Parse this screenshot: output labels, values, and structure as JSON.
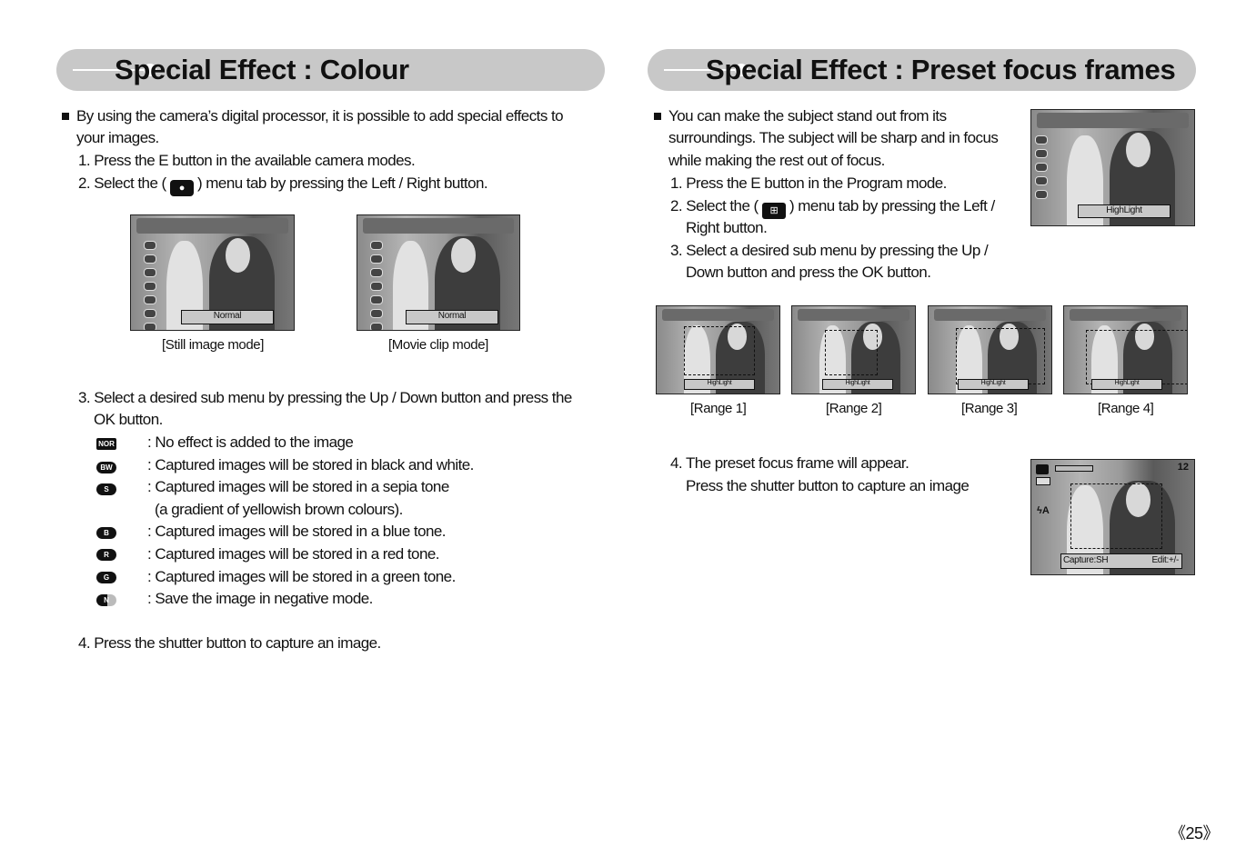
{
  "left": {
    "title": "Special Effect : Colour",
    "intro": [
      "By using the camera’s digital processor, it is possible to add special effects to",
      "your images."
    ],
    "step1": "1. Press the E button in the available camera modes.",
    "step2_a": "2. Select the (",
    "step2_b": ") menu tab by pressing the Left / Right button.",
    "screens": [
      {
        "label": "Normal",
        "caption": "[Still image mode]"
      },
      {
        "label": "Normal",
        "caption": "[Movie clip mode]"
      }
    ],
    "step3": [
      "3. Select a desired sub menu by pressing the Up / Down button and press the",
      "OK button."
    ],
    "effects": [
      {
        "icon": "NOR",
        "text": ": No effect is added to the image"
      },
      {
        "icon": "BW",
        "text": ": Captured images will be stored in black and white."
      },
      {
        "icon": "S",
        "text": ": Captured images will be stored in a sepia tone"
      },
      {
        "icon": "",
        "text": "(a gradient of yellowish brown colours)."
      },
      {
        "icon": "B",
        "text": ": Captured images will be stored in a blue tone."
      },
      {
        "icon": "R",
        "text": ": Captured images will be stored in a red tone."
      },
      {
        "icon": "G",
        "text": ": Captured images will be stored in a green tone."
      },
      {
        "icon": "N",
        "text": ": Save the image in negative mode."
      }
    ],
    "step4": "4. Press the shutter button to capture an image."
  },
  "right": {
    "title": "Special Effect : Preset focus frames",
    "intro": [
      "You can make the subject stand out from its",
      "surroundings. The subject will be sharp and in focus",
      "while making the rest out of focus."
    ],
    "step1": "1. Press the E button in the Program mode.",
    "step2_a": "2. Select the (",
    "step2_b": ") menu tab by pressing the Left /",
    "step2_c": "Right button.",
    "step3": [
      "3. Select a desired sub menu by pressing the Up /",
      "Down button and press the OK button."
    ],
    "top_screen_label": "HighLight",
    "ranges": [
      {
        "label": "HighLight",
        "caption": "[Range 1]"
      },
      {
        "label": "HighLight",
        "caption": "[Range 2]"
      },
      {
        "label": "HighLight",
        "caption": "[Range 3]"
      },
      {
        "label": "HighLight",
        "caption": "[Range 4]"
      }
    ],
    "step4": [
      "4. The preset focus frame will appear.",
      "Press the shutter button to capture an image"
    ],
    "capture_screen": {
      "left": "Capture:SH",
      "right": "Edit:+/-",
      "count": "12"
    }
  },
  "page_number": "《25》"
}
